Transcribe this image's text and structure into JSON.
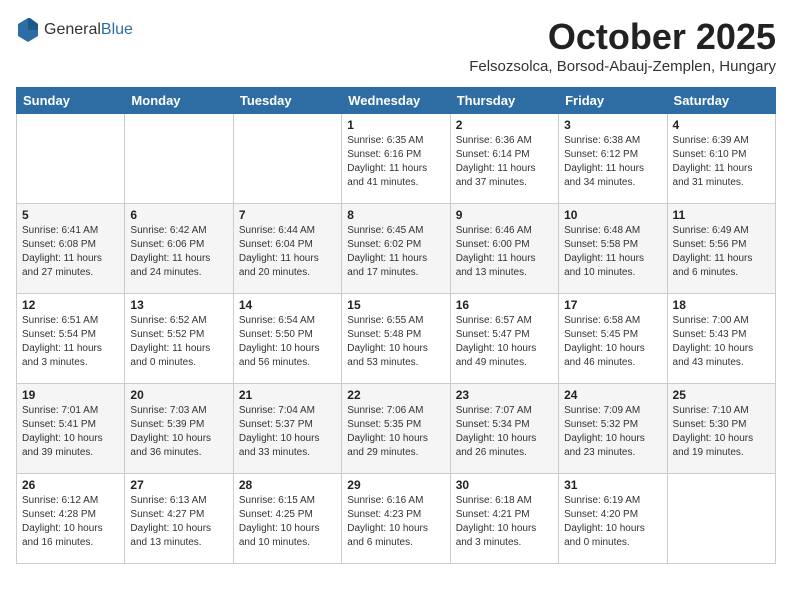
{
  "header": {
    "logo_general": "General",
    "logo_blue": "Blue",
    "month_title": "October 2025",
    "subtitle": "Felsozsolca, Borsod-Abauj-Zemplen, Hungary"
  },
  "days_of_week": [
    "Sunday",
    "Monday",
    "Tuesday",
    "Wednesday",
    "Thursday",
    "Friday",
    "Saturday"
  ],
  "weeks": [
    [
      {
        "day": "",
        "content": ""
      },
      {
        "day": "",
        "content": ""
      },
      {
        "day": "",
        "content": ""
      },
      {
        "day": "1",
        "content": "Sunrise: 6:35 AM\nSunset: 6:16 PM\nDaylight: 11 hours and 41 minutes."
      },
      {
        "day": "2",
        "content": "Sunrise: 6:36 AM\nSunset: 6:14 PM\nDaylight: 11 hours and 37 minutes."
      },
      {
        "day": "3",
        "content": "Sunrise: 6:38 AM\nSunset: 6:12 PM\nDaylight: 11 hours and 34 minutes."
      },
      {
        "day": "4",
        "content": "Sunrise: 6:39 AM\nSunset: 6:10 PM\nDaylight: 11 hours and 31 minutes."
      }
    ],
    [
      {
        "day": "5",
        "content": "Sunrise: 6:41 AM\nSunset: 6:08 PM\nDaylight: 11 hours and 27 minutes."
      },
      {
        "day": "6",
        "content": "Sunrise: 6:42 AM\nSunset: 6:06 PM\nDaylight: 11 hours and 24 minutes."
      },
      {
        "day": "7",
        "content": "Sunrise: 6:44 AM\nSunset: 6:04 PM\nDaylight: 11 hours and 20 minutes."
      },
      {
        "day": "8",
        "content": "Sunrise: 6:45 AM\nSunset: 6:02 PM\nDaylight: 11 hours and 17 minutes."
      },
      {
        "day": "9",
        "content": "Sunrise: 6:46 AM\nSunset: 6:00 PM\nDaylight: 11 hours and 13 minutes."
      },
      {
        "day": "10",
        "content": "Sunrise: 6:48 AM\nSunset: 5:58 PM\nDaylight: 11 hours and 10 minutes."
      },
      {
        "day": "11",
        "content": "Sunrise: 6:49 AM\nSunset: 5:56 PM\nDaylight: 11 hours and 6 minutes."
      }
    ],
    [
      {
        "day": "12",
        "content": "Sunrise: 6:51 AM\nSunset: 5:54 PM\nDaylight: 11 hours and 3 minutes."
      },
      {
        "day": "13",
        "content": "Sunrise: 6:52 AM\nSunset: 5:52 PM\nDaylight: 11 hours and 0 minutes."
      },
      {
        "day": "14",
        "content": "Sunrise: 6:54 AM\nSunset: 5:50 PM\nDaylight: 10 hours and 56 minutes."
      },
      {
        "day": "15",
        "content": "Sunrise: 6:55 AM\nSunset: 5:48 PM\nDaylight: 10 hours and 53 minutes."
      },
      {
        "day": "16",
        "content": "Sunrise: 6:57 AM\nSunset: 5:47 PM\nDaylight: 10 hours and 49 minutes."
      },
      {
        "day": "17",
        "content": "Sunrise: 6:58 AM\nSunset: 5:45 PM\nDaylight: 10 hours and 46 minutes."
      },
      {
        "day": "18",
        "content": "Sunrise: 7:00 AM\nSunset: 5:43 PM\nDaylight: 10 hours and 43 minutes."
      }
    ],
    [
      {
        "day": "19",
        "content": "Sunrise: 7:01 AM\nSunset: 5:41 PM\nDaylight: 10 hours and 39 minutes."
      },
      {
        "day": "20",
        "content": "Sunrise: 7:03 AM\nSunset: 5:39 PM\nDaylight: 10 hours and 36 minutes."
      },
      {
        "day": "21",
        "content": "Sunrise: 7:04 AM\nSunset: 5:37 PM\nDaylight: 10 hours and 33 minutes."
      },
      {
        "day": "22",
        "content": "Sunrise: 7:06 AM\nSunset: 5:35 PM\nDaylight: 10 hours and 29 minutes."
      },
      {
        "day": "23",
        "content": "Sunrise: 7:07 AM\nSunset: 5:34 PM\nDaylight: 10 hours and 26 minutes."
      },
      {
        "day": "24",
        "content": "Sunrise: 7:09 AM\nSunset: 5:32 PM\nDaylight: 10 hours and 23 minutes."
      },
      {
        "day": "25",
        "content": "Sunrise: 7:10 AM\nSunset: 5:30 PM\nDaylight: 10 hours and 19 minutes."
      }
    ],
    [
      {
        "day": "26",
        "content": "Sunrise: 6:12 AM\nSunset: 4:28 PM\nDaylight: 10 hours and 16 minutes."
      },
      {
        "day": "27",
        "content": "Sunrise: 6:13 AM\nSunset: 4:27 PM\nDaylight: 10 hours and 13 minutes."
      },
      {
        "day": "28",
        "content": "Sunrise: 6:15 AM\nSunset: 4:25 PM\nDaylight: 10 hours and 10 minutes."
      },
      {
        "day": "29",
        "content": "Sunrise: 6:16 AM\nSunset: 4:23 PM\nDaylight: 10 hours and 6 minutes."
      },
      {
        "day": "30",
        "content": "Sunrise: 6:18 AM\nSunset: 4:21 PM\nDaylight: 10 hours and 3 minutes."
      },
      {
        "day": "31",
        "content": "Sunrise: 6:19 AM\nSunset: 4:20 PM\nDaylight: 10 hours and 0 minutes."
      },
      {
        "day": "",
        "content": ""
      }
    ]
  ]
}
